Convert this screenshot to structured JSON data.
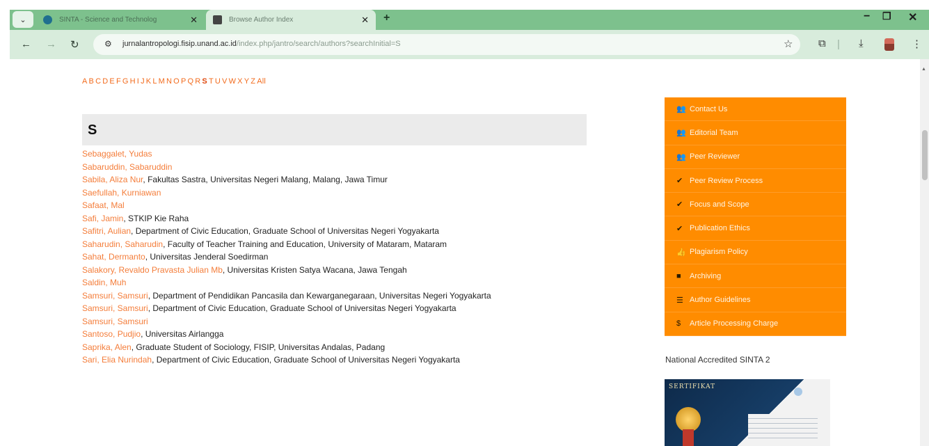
{
  "browser": {
    "tabs": [
      {
        "title": "SINTA - Science and Technolog"
      },
      {
        "title": "Browse Author Index"
      }
    ],
    "url_host": "jurnalantropologi.fisip.unand.ac.id",
    "url_path": "/index.php/jantro/search/authors?searchInitial=S",
    "icons": {
      "tab_menu": "chevron-down-icon",
      "close": "close-icon",
      "new_tab": "plus-icon",
      "back": "back-arrow-icon",
      "forward": "forward-arrow-icon",
      "reload": "reload-icon",
      "site_info": "tune-icon",
      "bookmark": "star-icon",
      "extensions": "puzzle-icon",
      "download": "download-icon",
      "menu": "kebab-menu-icon"
    }
  },
  "alphabet": {
    "letters": [
      "A",
      "B",
      "C",
      "D",
      "E",
      "F",
      "G",
      "H",
      "I",
      "J",
      "K",
      "L",
      "M",
      "N",
      "O",
      "P",
      "Q",
      "R",
      "S",
      "T",
      "U",
      "V",
      "W",
      "X",
      "Y",
      "Z"
    ],
    "all_label": "All",
    "current": "S"
  },
  "section_letter": "S",
  "authors": [
    {
      "name": "Sebaggalet, Yudas",
      "affiliation": ""
    },
    {
      "name": "Sabaruddin, Sabaruddin",
      "affiliation": ""
    },
    {
      "name": "Sabila, Aliza Nur",
      "affiliation": "Fakultas Sastra, Universitas Negeri Malang, Malang, Jawa Timur"
    },
    {
      "name": "Saefullah, Kurniawan",
      "affiliation": ""
    },
    {
      "name": "Safaat, Mal",
      "affiliation": ""
    },
    {
      "name": "Safi, Jamin",
      "affiliation": "STKIP Kie Raha"
    },
    {
      "name": "Safitri, Aulian",
      "affiliation": "Department of Civic Education, Graduate School of Universitas Negeri Yogyakarta"
    },
    {
      "name": "Saharudin, Saharudin",
      "affiliation": "Faculty of Teacher Training and Education, University of Mataram, Mataram"
    },
    {
      "name": "Sahat, Dermanto",
      "affiliation": "Universitas Jenderal Soedirman"
    },
    {
      "name": "Salakory, Revaldo Pravasta Julian Mb",
      "affiliation": "Universitas Kristen Satya Wacana, Jawa Tengah"
    },
    {
      "name": "Saldin, Muh",
      "affiliation": ""
    },
    {
      "name": "Samsuri, Samsuri",
      "affiliation": "Department of Pendidikan Pancasila dan Kewarganegaraan, Universitas Negeri Yogyakarta"
    },
    {
      "name": "Samsuri, Samsuri",
      "affiliation": "Department of Civic Education, Graduate School of Universitas Negeri Yogyakarta"
    },
    {
      "name": "Samsuri, Samsuri",
      "affiliation": ""
    },
    {
      "name": "Santoso, Pudjio",
      "affiliation": "Universitas Airlangga"
    },
    {
      "name": "Saprika, Alen",
      "affiliation": "Graduate Student of Sociology, FISIP, Universitas Andalas, Padang"
    },
    {
      "name": "Sari, Elia Nurindah",
      "affiliation": "Department of Civic Education, Graduate School of Universitas Negeri Yogyakarta"
    }
  ],
  "sidebar": {
    "menu": [
      {
        "label": "Contact Us",
        "icon": "users-icon",
        "glyph": "👥"
      },
      {
        "label": "Editorial Team",
        "icon": "users-icon",
        "glyph": "👥"
      },
      {
        "label": "Peer Reviewer",
        "icon": "users-icon",
        "glyph": "👥"
      },
      {
        "label": "Peer Review Process",
        "icon": "check-icon",
        "glyph": "✔"
      },
      {
        "label": "Focus and Scope",
        "icon": "check-icon",
        "glyph": "✔"
      },
      {
        "label": "Publication Ethics",
        "icon": "check-icon",
        "glyph": "✔"
      },
      {
        "label": "Plagiarism Policy",
        "icon": "thumbs-up-icon",
        "glyph": "👍"
      },
      {
        "label": "Archiving",
        "icon": "book-icon",
        "glyph": "■"
      },
      {
        "label": "Author Guidelines",
        "icon": "list-icon",
        "glyph": "☰"
      },
      {
        "label": "Article Processing Charge",
        "icon": "dollar-icon",
        "glyph": "$"
      }
    ],
    "accreditation_label": "National Accredited SINTA 2",
    "certificate_title": "SERTIFIKAT"
  }
}
